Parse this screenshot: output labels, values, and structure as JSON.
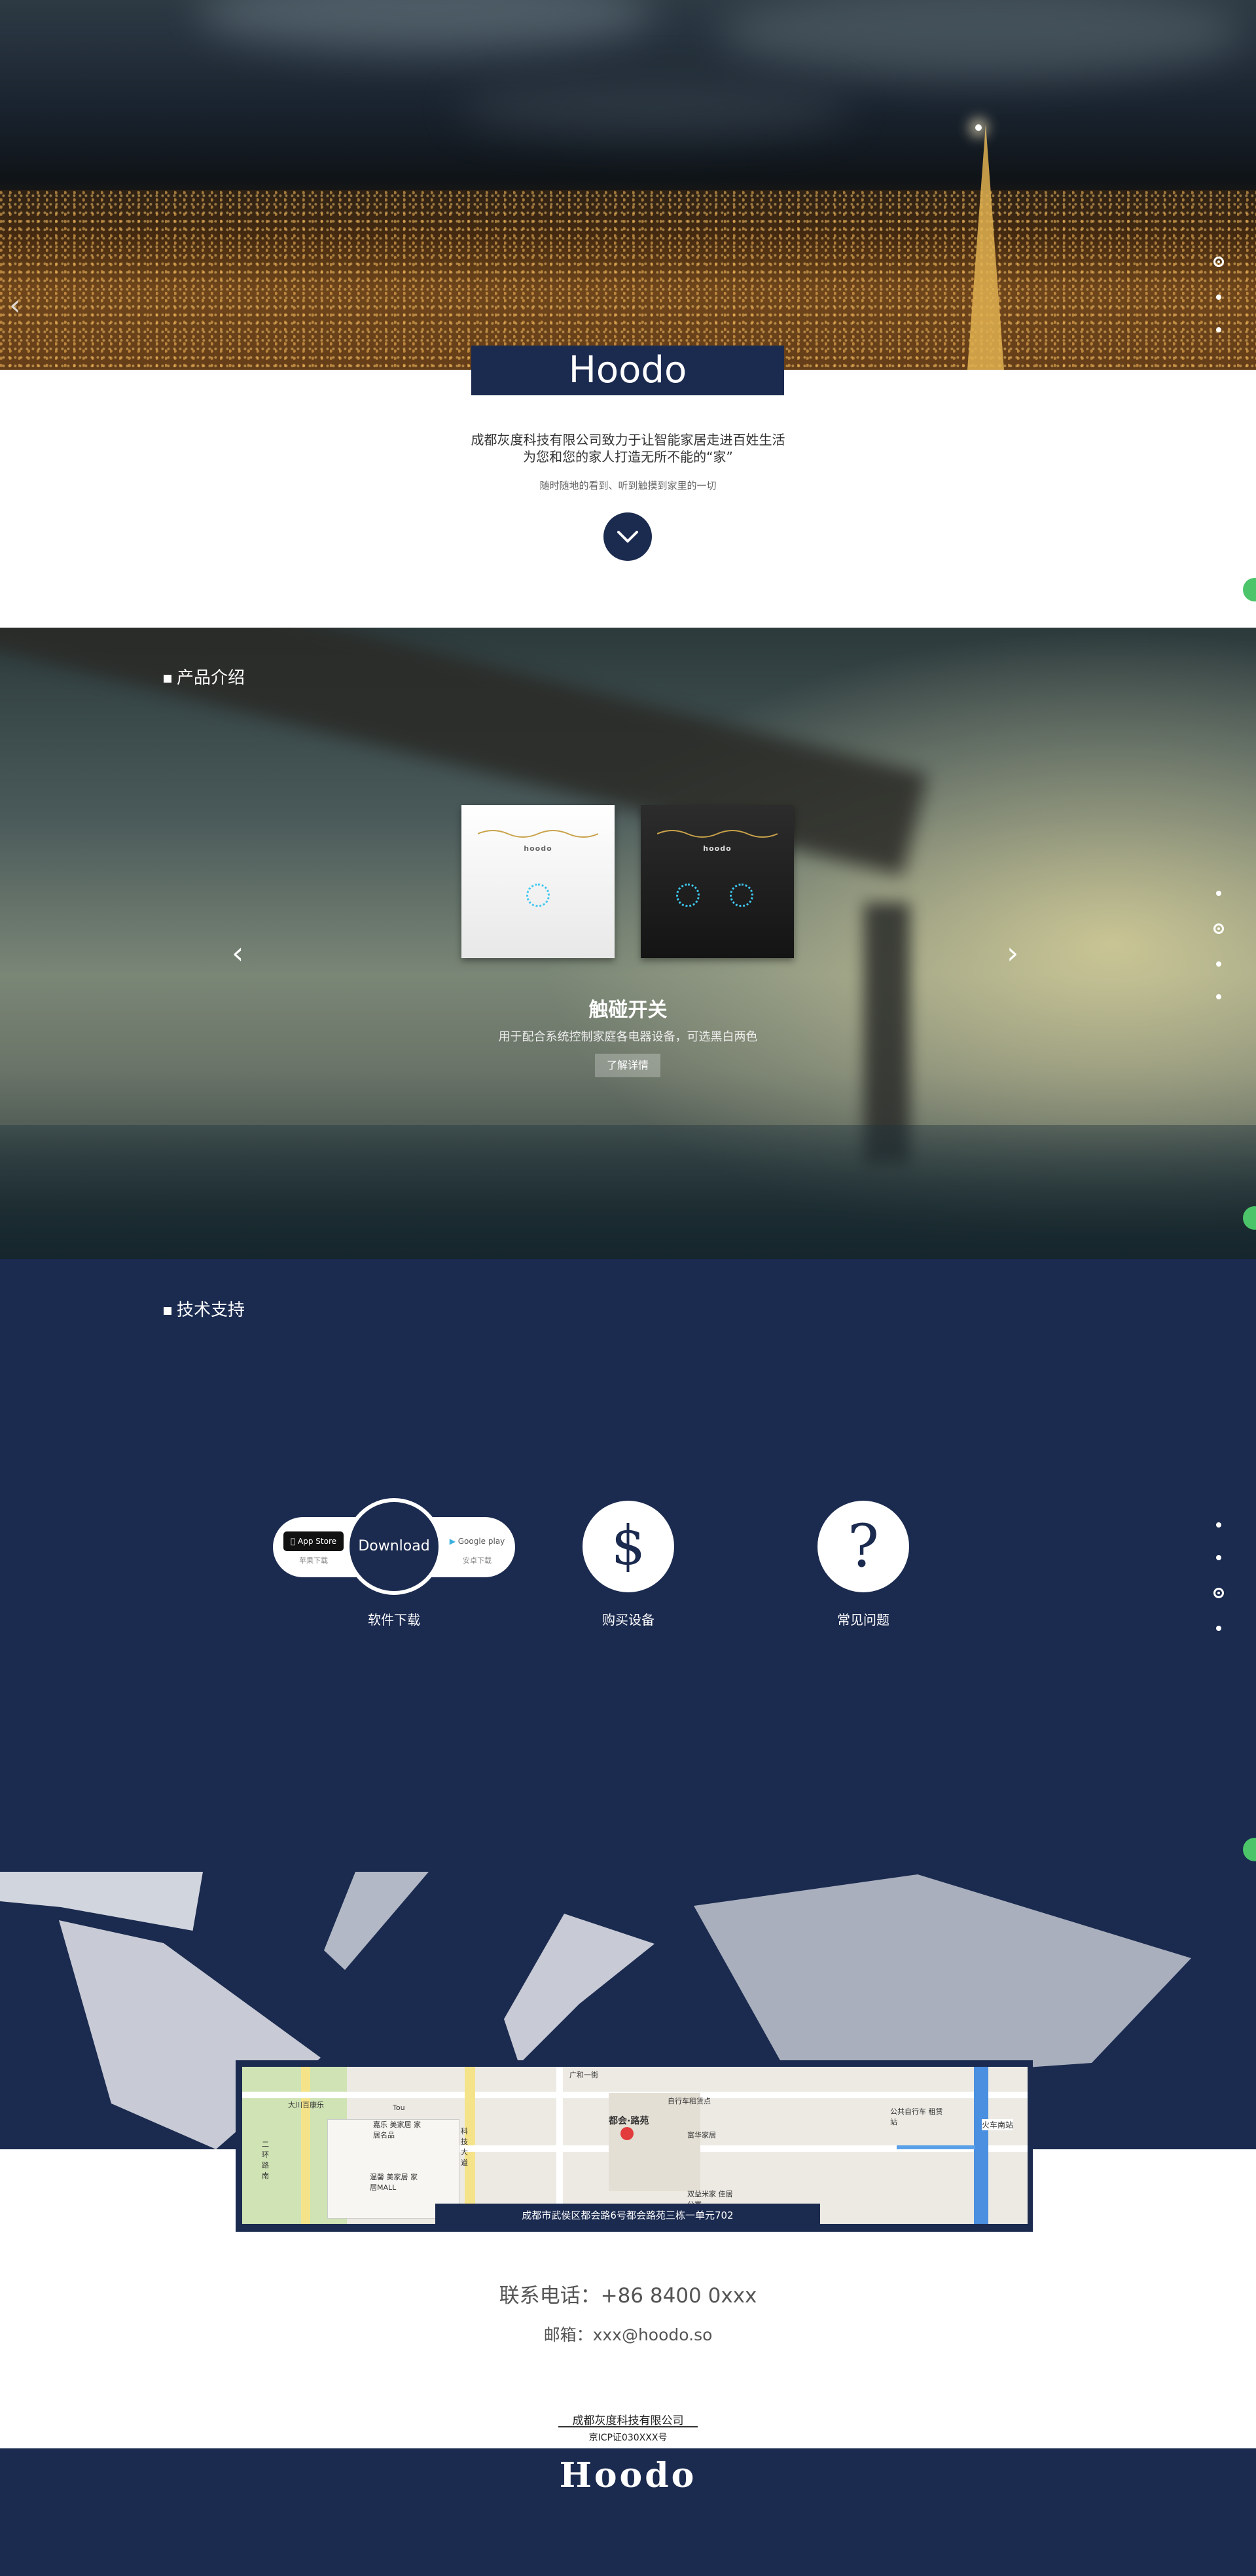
{
  "hero": {
    "brand": "Hoodo",
    "tagline_1": "成都灰度科技有限公司致力于让智能家居走进百姓生活",
    "tagline_2": "为您和您的家人打造无所不能的“家”",
    "subline": "随时随地的看到、听到触摸到家里的一切",
    "prev_arrow": "‹"
  },
  "products": {
    "section_title": "产品介绍",
    "panel_logo": "hoodo",
    "name": "触碰开关",
    "description": "用于配合系统控制家庭各电器设备，可选黑白两色",
    "more_button": "了解详情",
    "prev_arrow": "‹",
    "next_arrow": "›"
  },
  "support": {
    "section_title": "技术支持",
    "appstore_label": "App Store",
    "appstore_sub": "苹果下载",
    "download_button": "Download",
    "googleplay_label": "Google play",
    "googleplay_sub": "安卓下载",
    "items": [
      {
        "label": "软件下载",
        "icon": "download-icon"
      },
      {
        "label": "购买设备",
        "icon": "dollar-icon",
        "glyph": "$"
      },
      {
        "label": "常见问题",
        "icon": "question-icon",
        "glyph": "?"
      }
    ]
  },
  "map": {
    "address": "成都市武侯区都会路6号都会路苑三栋一单元702",
    "labels": [
      "大川百康乐",
      "Tou",
      "嘉乐 美家居 家居名品",
      "温馨 美家居 家居MALL",
      "都会·路苑",
      "自行车租赁点",
      "火车南站",
      "公共自行车 租赁站",
      "广和一街",
      "富华家居",
      "双益米家 佳居公寓",
      "科技大道",
      "二环路南"
    ]
  },
  "contact": {
    "phone": "联系电话：+86 8400 0xxx",
    "email": "邮箱：xxx@hoodo.so"
  },
  "footer": {
    "company": "成都灰度科技有限公司",
    "icp": "京ICP证030XXX号",
    "logo": "Hoodo"
  },
  "colors": {
    "navy": "#1b2a4f",
    "side_tab": "#4bc46a"
  }
}
